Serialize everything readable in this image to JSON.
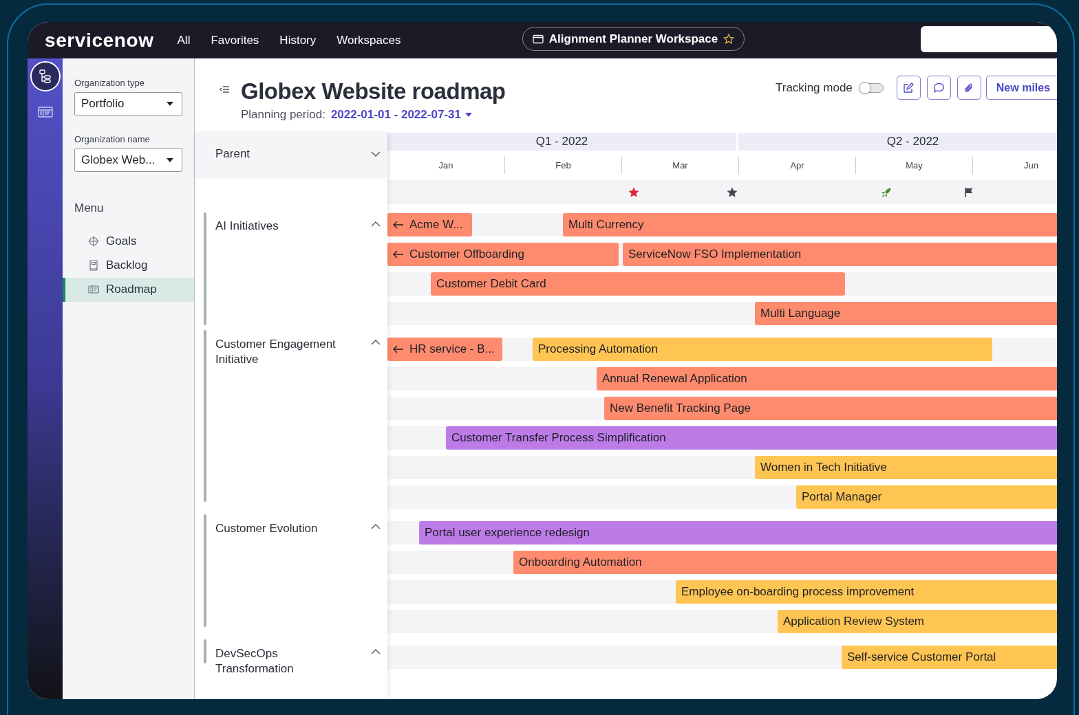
{
  "top_bar": {
    "logo": "servicenow",
    "nav": [
      "All",
      "Favorites",
      "History",
      "Workspaces"
    ],
    "workspace_tab": {
      "label": "Alignment Planner Workspace",
      "favorite": false
    }
  },
  "rail": [
    {
      "selected": true
    },
    {
      "selected": false
    }
  ],
  "sidebar": {
    "fields": [
      {
        "label": "Organization type",
        "value": "Portfolio"
      },
      {
        "label": "Organization name",
        "value": "Globex Web..."
      }
    ],
    "menu_title": "Menu",
    "menu": [
      {
        "label": "Goals",
        "selected": false
      },
      {
        "label": "Backlog",
        "selected": false
      },
      {
        "label": "Roadmap",
        "selected": true
      }
    ]
  },
  "header": {
    "title": "Globex Website roadmap",
    "period_label": "Planning period:",
    "period": "2022-01-01 - 2022-07-31",
    "tracking_mode": {
      "label": "Tracking mode",
      "on": false
    },
    "action_button": "New miles"
  },
  "timeline": {
    "parent_column": "Parent",
    "quarters": [
      "Q1 - 2022",
      "Q2 - 2022"
    ],
    "months": [
      "Jan",
      "Feb",
      "Mar",
      "Apr",
      "May",
      "Jun"
    ],
    "milestones": [
      {
        "kind": "star",
        "color": "#e0263f"
      },
      {
        "kind": "star",
        "color": "#45484f"
      },
      {
        "kind": "rocket",
        "color": "#3e8e22"
      },
      {
        "kind": "flag",
        "color": "#45484f"
      }
    ]
  },
  "groups": [
    {
      "name": "AI Initiatives",
      "expanded": true,
      "rows": [
        {
          "bars": [
            {
              "label": "Acme W...",
              "continues_before": true,
              "color": "#ff8b6e"
            },
            {
              "label": "Multi Currency",
              "color": "#ff8b6e"
            }
          ]
        },
        {
          "bars": [
            {
              "label": "Customer Offboarding",
              "continues_before": true,
              "color": "#ff8b6e"
            },
            {
              "label": "ServiceNow FSO Implementation",
              "color": "#ff8b6e"
            }
          ]
        },
        {
          "bars": [
            {
              "label": "Customer Debit Card",
              "color": "#ff8b6e"
            }
          ]
        },
        {
          "bars": [
            {
              "label": "Multi Language",
              "color": "#ff8b6e"
            }
          ]
        }
      ]
    },
    {
      "name": "Customer Engagement Initiative",
      "expanded": true,
      "rows": [
        {
          "bars": [
            {
              "label": "HR service - B...",
              "continues_before": true,
              "color": "#ff8b6e"
            },
            {
              "label": "Processing Automation",
              "color": "#ffc553"
            }
          ]
        },
        {
          "bars": [
            {
              "label": "Annual Renewal Application",
              "color": "#ff8b6e"
            }
          ]
        },
        {
          "bars": [
            {
              "label": "New Benefit Tracking Page",
              "color": "#ff8b6e"
            }
          ]
        },
        {
          "bars": [
            {
              "label": "Customer Transfer Process Simplification",
              "color": "#bd7be8"
            }
          ]
        },
        {
          "bars": [
            {
              "label": "Women in Tech Initiative",
              "color": "#ffc553"
            }
          ]
        },
        {
          "bars": [
            {
              "label": "Portal Manager",
              "color": "#ffc553"
            }
          ]
        }
      ]
    },
    {
      "name": "Customer Evolution",
      "expanded": true,
      "rows": [
        {
          "bars": [
            {
              "label": "Portal user experience redesign",
              "color": "#bd7be8"
            }
          ]
        },
        {
          "bars": [
            {
              "label": "Onboarding Automation",
              "color": "#ff8b6e"
            }
          ]
        },
        {
          "bars": [
            {
              "label": "Employee on-boarding process improvement",
              "color": "#ffc553"
            }
          ]
        },
        {
          "bars": [
            {
              "label": "Application Review System",
              "color": "#ffc553"
            }
          ]
        }
      ]
    },
    {
      "name": "DevSecOps Transformation",
      "expanded": true,
      "rows": [
        {
          "bars": [
            {
              "label": "Self-service Customer Portal",
              "color": "#ffc553"
            }
          ]
        }
      ]
    }
  ]
}
